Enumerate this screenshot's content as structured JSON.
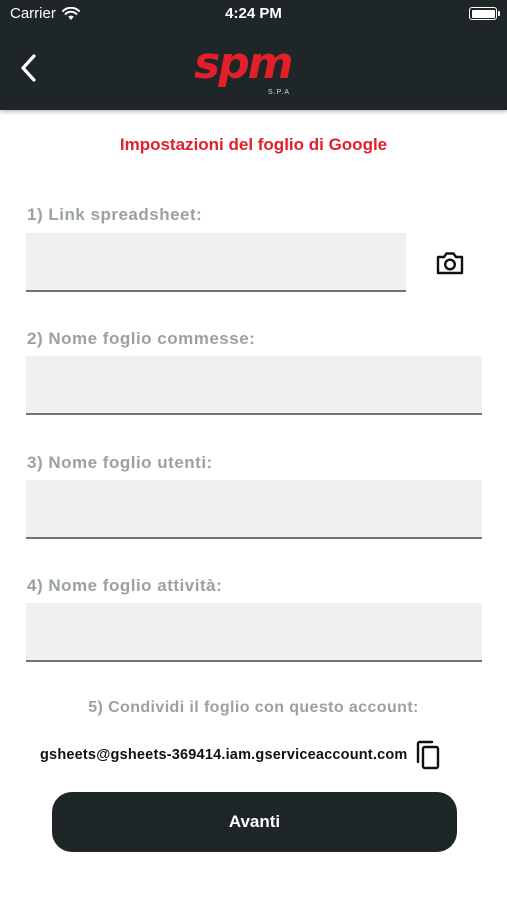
{
  "status_bar": {
    "carrier": "Carrier",
    "time": "4:24 PM",
    "wifi_icon": "wifi-icon",
    "battery_icon": "battery-icon"
  },
  "nav": {
    "back_icon": "chevron-left-icon",
    "logo_text": "spm",
    "logo_subtext": "S.P.A"
  },
  "colors": {
    "header_bg": "#1e2628",
    "accent_red": "#e2202a",
    "label_gray": "#9aa1a5",
    "input_bg": "#f0f0f0"
  },
  "form": {
    "title": "Impostazioni del foglio di Google",
    "fields": [
      {
        "label": "1) Link spreadsheet:",
        "value": ""
      },
      {
        "label": "2) Nome foglio commesse:",
        "value": ""
      },
      {
        "label": "3) Nome foglio utenti:",
        "value": ""
      },
      {
        "label": "4) Nome foglio attività:",
        "value": ""
      }
    ],
    "camera_icon": "camera-icon",
    "share_label": "5) Condividi il foglio con questo account:",
    "account_email": "gsheets@gsheets-369414.iam.gserviceaccount.com",
    "copy_icon": "copy-icon",
    "next_button": "Avanti"
  }
}
